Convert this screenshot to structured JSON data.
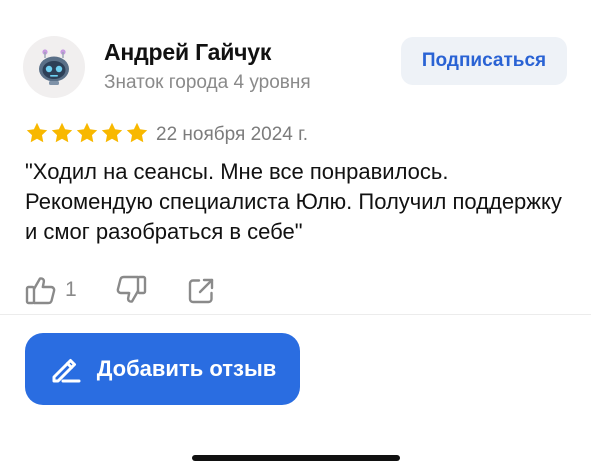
{
  "author": {
    "name": "Андрей Гайчук",
    "level": "Знаток города 4 уровня",
    "avatar_icon": "robot-avatar-icon"
  },
  "subscribe_label": "Подписаться",
  "review": {
    "rating": 5,
    "max_rating": 5,
    "date": "22 ноября 2024 г.",
    "text": "\"Ходил на сеансы. Мне все понравилось. Рекомендую специалиста Юлю. Получил поддержку и смог разобраться в себе\""
  },
  "actions": {
    "like_count": "1",
    "like_icon": "thumbs-up-icon",
    "dislike_icon": "thumbs-down-icon",
    "share_icon": "share-icon"
  },
  "add_review_label": "Добавить отзыв",
  "colors": {
    "star": "#f8b800",
    "primary_button": "#2a6de1",
    "subscribe_bg": "#eef2f7",
    "subscribe_text": "#2a63d4"
  }
}
